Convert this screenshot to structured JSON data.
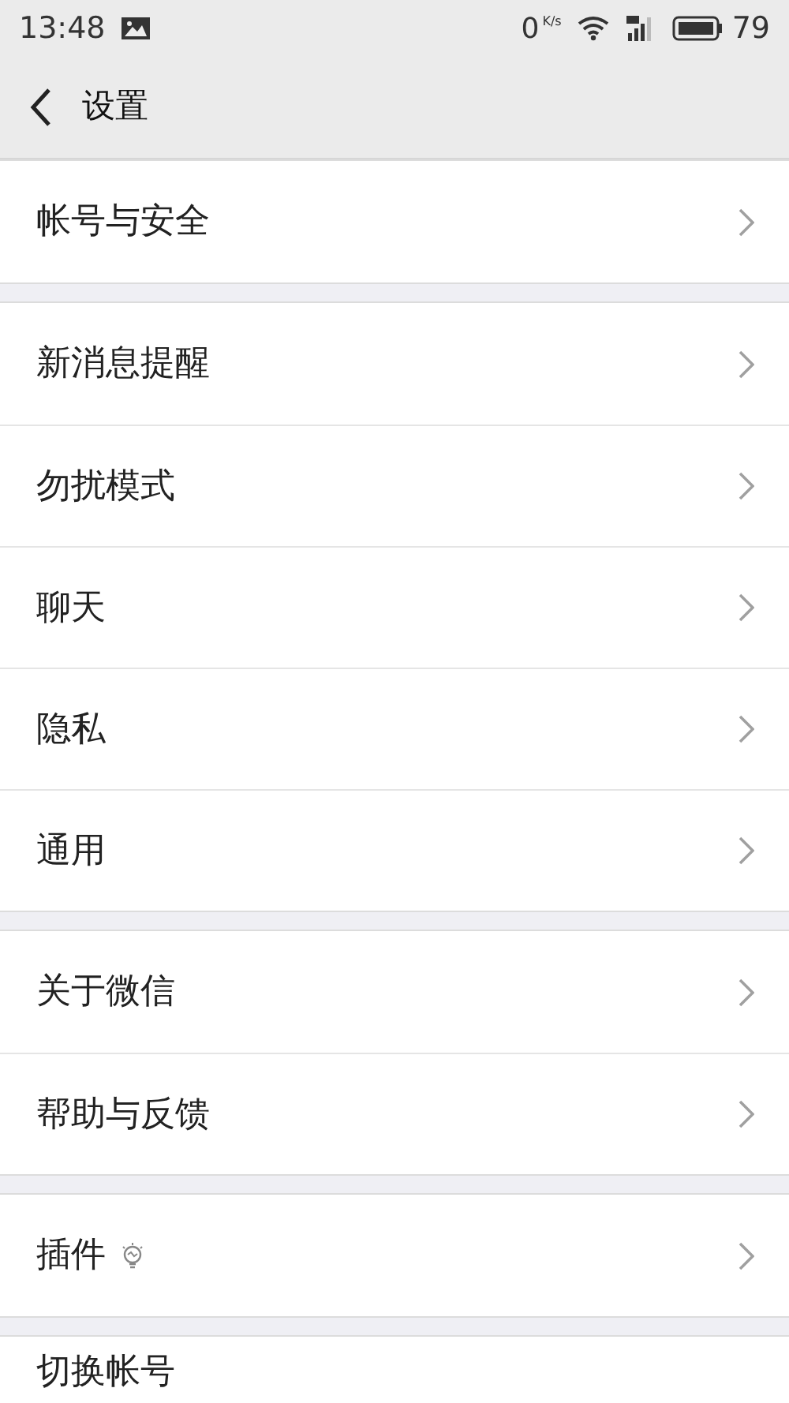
{
  "status_bar": {
    "time": "13:48",
    "speed": "0",
    "speed_unit": "K/s",
    "battery": "79"
  },
  "header": {
    "title": "设置"
  },
  "sections": [
    {
      "items": [
        {
          "label": "帐号与安全",
          "kind": "link"
        }
      ]
    },
    {
      "items": [
        {
          "label": "新消息提醒",
          "kind": "link"
        },
        {
          "label": "勿扰模式",
          "kind": "link"
        },
        {
          "label": "聊天",
          "kind": "link"
        },
        {
          "label": "隐私",
          "kind": "link"
        },
        {
          "label": "通用",
          "kind": "link"
        }
      ]
    },
    {
      "items": [
        {
          "label": "关于微信",
          "kind": "link"
        },
        {
          "label": "帮助与反馈",
          "kind": "link"
        }
      ]
    },
    {
      "items": [
        {
          "label": "插件",
          "kind": "link-bulb"
        }
      ]
    },
    {
      "items": [
        {
          "label": "切换帐号",
          "kind": "text"
        }
      ]
    }
  ]
}
